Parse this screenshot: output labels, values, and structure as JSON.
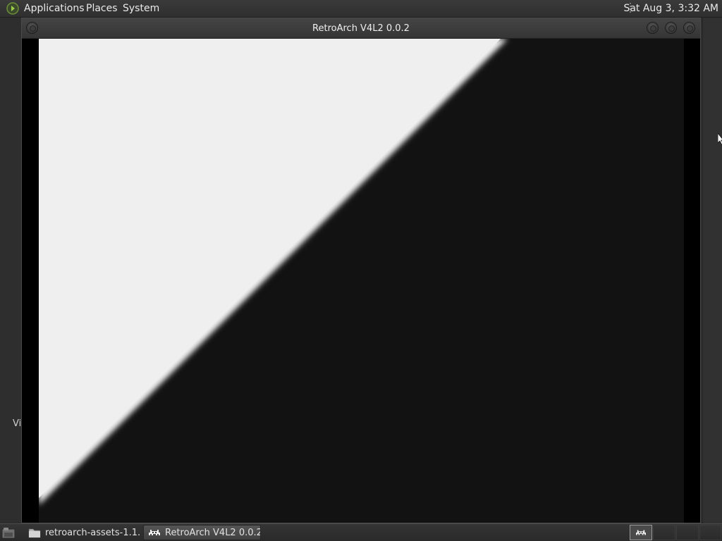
{
  "top_panel": {
    "menus": [
      "Applications",
      "Places",
      "System"
    ],
    "clock": "Sat Aug  3,  3:32 AM"
  },
  "desktop": {
    "partial_label": "Vi"
  },
  "window": {
    "title": "RetroArch V4L2 0.0.2",
    "controls": [
      "minimize",
      "maximize",
      "close"
    ]
  },
  "taskbar": {
    "tasks": [
      {
        "label": "retroarch-assets-1.1...",
        "icon": "folder-icon",
        "active": false
      },
      {
        "label": "RetroArch V4L2 0.0.2",
        "icon": "retroarch-invader-icon",
        "active": true
      }
    ]
  },
  "colors": {
    "panel": "#2f2f2f",
    "video_light": "#efefef",
    "video_dark": "#121212"
  }
}
